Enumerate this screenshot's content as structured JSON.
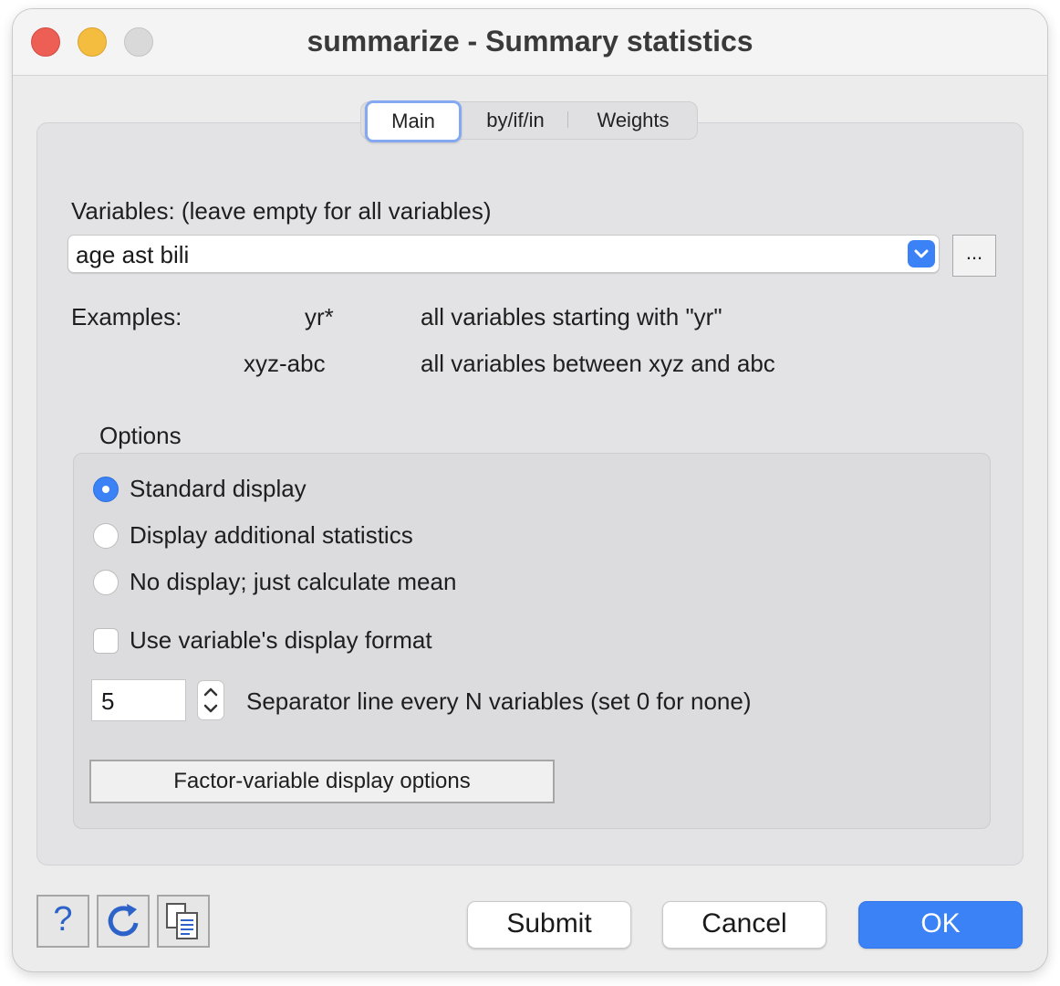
{
  "window": {
    "title": "summarize - Summary statistics"
  },
  "tabs": [
    {
      "label": "Main",
      "active": true
    },
    {
      "label": "by/if/in",
      "active": false
    },
    {
      "label": "Weights",
      "active": false
    }
  ],
  "variables": {
    "label": "Variables: (leave empty for all variables)",
    "value": "age ast bili",
    "browse_label": "..."
  },
  "examples": {
    "label": "Examples:",
    "rows": [
      {
        "pattern": "yr*",
        "description": "all variables starting with \"yr\""
      },
      {
        "pattern": "xyz-abc",
        "description": "all variables between xyz and abc"
      }
    ]
  },
  "options": {
    "label": "Options",
    "radios": [
      {
        "label": "Standard display",
        "selected": true
      },
      {
        "label": "Display additional statistics",
        "selected": false
      },
      {
        "label": "No display; just calculate mean",
        "selected": false
      }
    ],
    "checkbox": {
      "label": "Use variable's display format",
      "checked": false
    },
    "separator": {
      "value": "5",
      "label": "Separator line every N variables (set 0 for none)"
    },
    "factor_button": "Factor-variable display options"
  },
  "footer": {
    "help_symbol": "?",
    "submit": "Submit",
    "cancel": "Cancel",
    "ok": "OK"
  },
  "colors": {
    "accent": "#3b82f6",
    "close": "#ed5e55",
    "minimize": "#f4bd40",
    "zoom": "#d9d9d9"
  }
}
